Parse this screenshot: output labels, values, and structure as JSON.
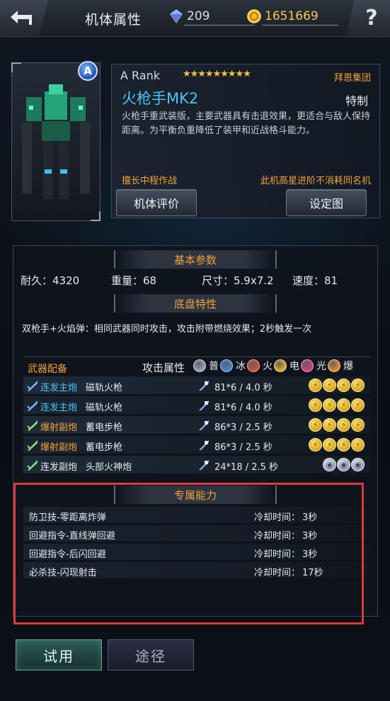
{
  "header": {
    "title": "机体属性",
    "crystals": "209",
    "gold": "1651669",
    "help": "?"
  },
  "mech": {
    "rank_badge": "A",
    "rank": "A  Rank",
    "stars": "★★★★★★★★★",
    "faction": "拜恩集团",
    "name": "火枪手MK2",
    "type": "特制",
    "description": "火枪手重武装版，主要武器具有击退效果，更适合与敌人保持距离。为平衡负重降低了装甲和近战格斗能力。",
    "specialty": "擅长中程作战",
    "note": "此机高星进阶不消耗同名机",
    "evaluate_button": "机体评价",
    "design_button": "设定图"
  },
  "basic": {
    "header": "基本参数",
    "durability": "耐久：4320",
    "weight": "重量：68",
    "size": "尺寸：5.9x7.2",
    "speed": "速度：81"
  },
  "chassis": {
    "header": "底盘特性",
    "text": "双枪手+火焰弹：相同武器同时攻击，攻击附带燃烧效果；2秒触发一次"
  },
  "weapons": {
    "header": "武器配备",
    "attr_label": "攻击属性",
    "legend": [
      {
        "label": "普",
        "color": "#9aa3bb"
      },
      {
        "label": "冰",
        "color": "#3f86e0"
      },
      {
        "label": "火",
        "color": "#e04a2a"
      },
      {
        "label": "电",
        "color": "#e8b020"
      },
      {
        "label": "光",
        "color": "#e03a7a"
      },
      {
        "label": "爆",
        "color": "#f08a2a"
      }
    ],
    "rows": [
      {
        "category": "连发主炮",
        "category_color": "#49c7f0",
        "name": "磁轨火枪",
        "damage": "81*6 / 4.0 秒",
        "slots": [
          "elec",
          "elec",
          "elec",
          "elec"
        ]
      },
      {
        "category": "连发主炮",
        "category_color": "#49c7f0",
        "name": "磁轨火枪",
        "damage": "81*6 / 4.0 秒",
        "slots": [
          "elec",
          "elec",
          "elec",
          "elec"
        ]
      },
      {
        "category": "爆射副炮",
        "category_color": "#f0a23a",
        "name": "蓄电步枪",
        "damage": "86*3 / 2.5 秒",
        "slots": [
          "elec",
          "elec",
          "elec",
          "elec"
        ]
      },
      {
        "category": "爆射副炮",
        "category_color": "#f0a23a",
        "name": "蓄电步枪",
        "damage": "86*3 / 2.5 秒",
        "slots": [
          "elec",
          "elec",
          "elec",
          "elec"
        ]
      },
      {
        "category": "连发副炮",
        "category_color": "#e6eaf0",
        "name": "头部火神炮",
        "damage": "24*18 / 2.5 秒",
        "slots": [
          "norm",
          "norm",
          "norm"
        ]
      }
    ]
  },
  "abilities": {
    "header": "专属能力",
    "cooldown_label": "冷却时间：",
    "rows": [
      {
        "name": "防卫技-零距离炸弹",
        "cooldown": "3秒"
      },
      {
        "name": "回避指令-直线弹回避",
        "cooldown": "3秒"
      },
      {
        "name": "回避指令-后闪回避",
        "cooldown": "3秒"
      },
      {
        "name": "必杀技-闪现射击",
        "cooldown": "17秒"
      }
    ]
  },
  "footer": {
    "try_button": "试用",
    "source_button": "途径"
  },
  "colors": {
    "accent_orange": "#f0a23a",
    "accent_cyan": "#49c7f0",
    "highlight_red": "#e0393e"
  }
}
